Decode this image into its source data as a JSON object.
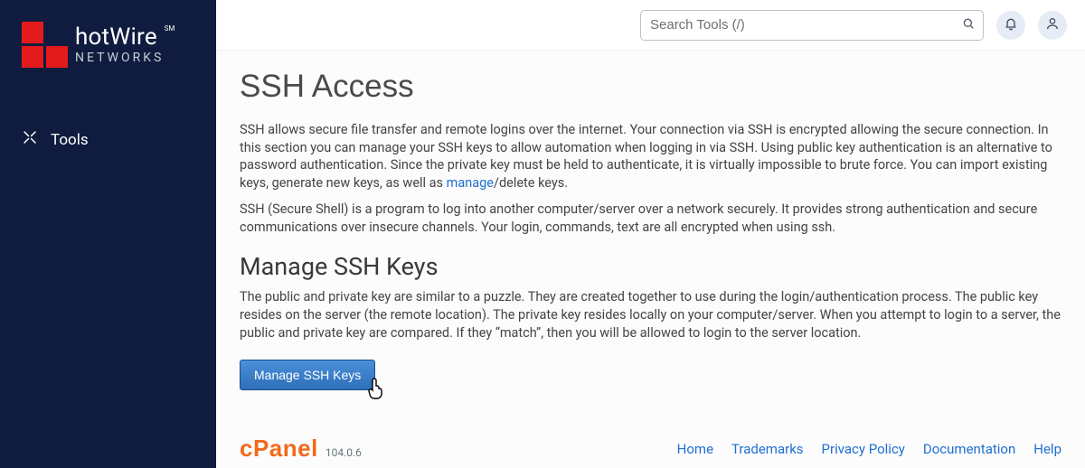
{
  "sidebar": {
    "brand_top": "hotWire",
    "brand_sm": "SM",
    "brand_bottom": "NETWORKS",
    "nav_item_label": "Tools"
  },
  "topbar": {
    "search_placeholder": "Search Tools (/)"
  },
  "content": {
    "title": "SSH Access",
    "para1_a": "SSH allows secure file transfer and remote logins over the internet. Your connection via SSH is encrypted allowing the secure connection. In this section you can manage your SSH keys to allow automation when logging in via SSH. Using public key authentication is an alternative to password authentication. Since the private key must be held to authenticate, it is virtually impossible to brute force. You can import existing keys, generate new keys, as well as ",
    "manage_link": "manage",
    "para1_b": "/delete keys.",
    "para2": "SSH (Secure Shell) is a program to log into another computer/server over a network securely. It provides strong authentication and secure communications over insecure channels. Your login, commands, text are all encrypted when using ssh.",
    "heading2": "Manage SSH Keys",
    "para3": "The public and private key are similar to a puzzle. They are created together to use during the login/authentication process. The public key resides on the server (the remote location). The private key resides locally on your computer/server. When you attempt to login to a server, the public and private key are compared. If they “match”, then you will be allowed to login to the server location.",
    "button_label": "Manage SSH Keys"
  },
  "footer": {
    "cpanel": "cPanel",
    "version": "104.0.6",
    "links": [
      "Home",
      "Trademarks",
      "Privacy Policy",
      "Documentation",
      "Help"
    ]
  }
}
